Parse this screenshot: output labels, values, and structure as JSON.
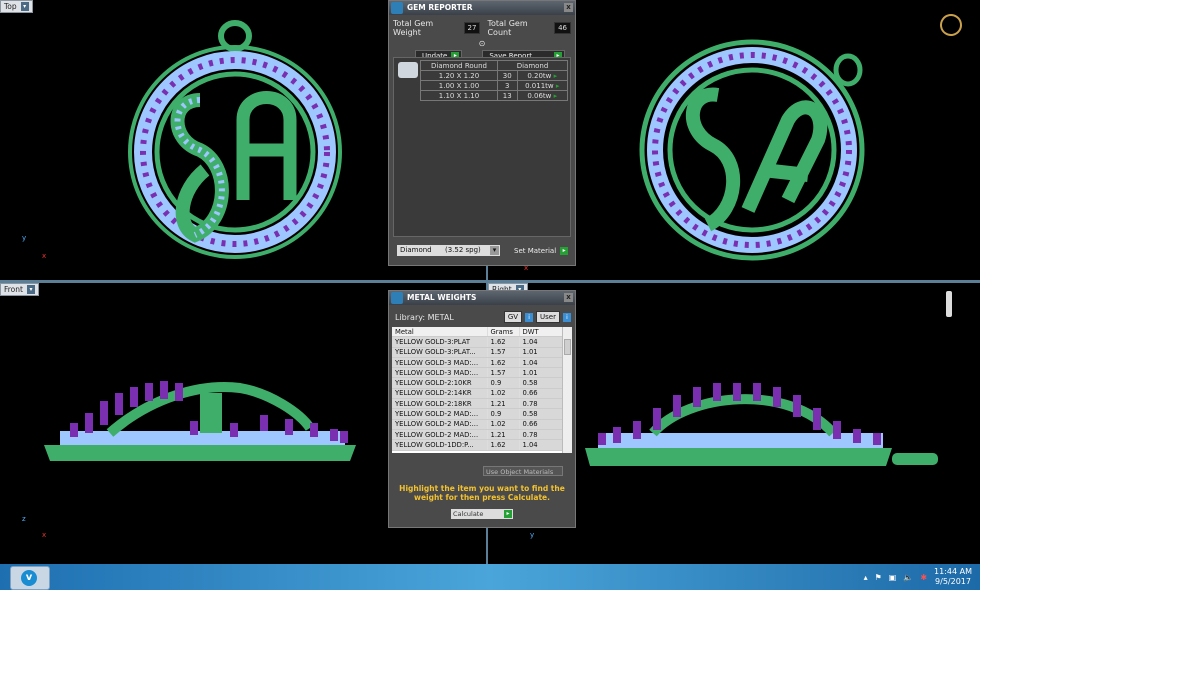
{
  "viewports": {
    "top": {
      "label": "Top",
      "axis_v": "y",
      "axis_h": "x"
    },
    "front": {
      "label": "Front",
      "axis_v": "z",
      "axis_h": "x"
    },
    "right": {
      "label": "Right",
      "axis_h": "y"
    },
    "perspective": {
      "axis_h": "x"
    }
  },
  "gem_reporter": {
    "title": "GEM REPORTER",
    "close": "x",
    "total_weight_label": "Total Gem Weight",
    "total_weight": "27",
    "total_count_label": "Total Gem Count",
    "total_count": "46",
    "update_label": "Update",
    "save_label": "Save Report",
    "shape_header": "Diamond Round",
    "material_header": "Diamond",
    "rows": [
      {
        "size": "1.20 X 1.20",
        "count": "30",
        "weight": "0.20tw"
      },
      {
        "size": "1.00 X 1.00",
        "count": "3",
        "weight": "0.011tw"
      },
      {
        "size": "1.10 X 1.10",
        "count": "13",
        "weight": "0.06tw"
      }
    ],
    "material_select": "Diamond      (3.52 spg)",
    "set_material_label": "Set Material"
  },
  "metal_weights": {
    "title": "METAL WEIGHTS",
    "library_label": "Library: METAL",
    "gv_label": "GV",
    "user_label": "User",
    "headers": [
      "Metal",
      "Grams",
      "DWT"
    ],
    "rows": [
      [
        "YELLOW GOLD-3:PLAT",
        "1.62",
        "1.04"
      ],
      [
        "YELLOW GOLD-3:PLAT...",
        "1.57",
        "1.01"
      ],
      [
        "YELLOW GOLD-3 MAD:...",
        "1.62",
        "1.04"
      ],
      [
        "YELLOW GOLD-3 MAD:...",
        "1.57",
        "1.01"
      ],
      [
        "YELLOW GOLD-2:10KR",
        "0.9",
        "0.58"
      ],
      [
        "YELLOW GOLD-2:14KR",
        "1.02",
        "0.66"
      ],
      [
        "YELLOW GOLD-2:18KR",
        "1.21",
        "0.78"
      ],
      [
        "YELLOW GOLD-2 MAD:...",
        "0.9",
        "0.58"
      ],
      [
        "YELLOW GOLD-2 MAD:...",
        "1.02",
        "0.66"
      ],
      [
        "YELLOW GOLD-2 MAD:...",
        "1.21",
        "0.78"
      ],
      [
        "YELLOW GOLD-1DD:P...",
        "1.62",
        "1.04"
      ]
    ],
    "use_object_label": "Use Object Materials",
    "hint": "Highlight the item you want to find the weight for then press Calculate.",
    "calculate_label": "Calculate"
  },
  "taskbar": {
    "time": "11:44 AM",
    "date": "9/5/2017"
  },
  "colors": {
    "metal": "#3fae6a",
    "gem_purple": "#7a2fb0",
    "gem_blue": "#9ec6ff"
  }
}
